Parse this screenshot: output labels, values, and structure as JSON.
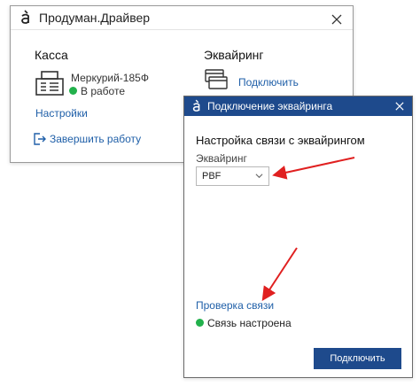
{
  "window1": {
    "title": "Продуман.Драйвер",
    "kassa": {
      "heading": "Касса",
      "device_name": "Меркурий-185Ф",
      "status": "В работе",
      "settings_link": "Настройки",
      "finish_link": "Завершить работу"
    },
    "acquiring": {
      "heading": "Эквайринг",
      "connect_link": "Подключить"
    }
  },
  "window2": {
    "title": "Подключение эквайринга",
    "heading": "Настройка связи с эквайрингом",
    "field_label": "Эквайринг",
    "select_value": "PBF",
    "check_link": "Проверка связи",
    "status": "Связь настроена",
    "connect_button": "Подключить"
  },
  "colors": {
    "accent": "#1e4a8c",
    "link": "#1f5fa8",
    "status_ok": "#22b14c",
    "annotation_arrow": "#e02020"
  }
}
